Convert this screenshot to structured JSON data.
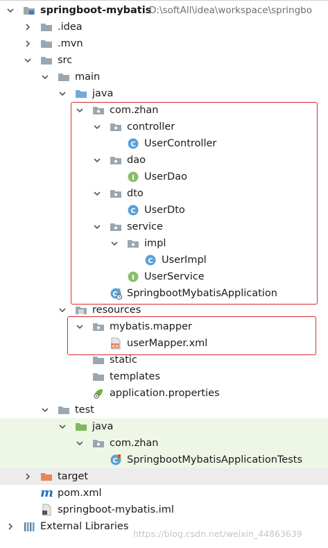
{
  "project_tree": {
    "root": {
      "name": "springboot-mybatis",
      "path": "D:\\softAll\\idea\\workspace\\springbo"
    },
    "idea": ".idea",
    "mvn": ".mvn",
    "src": "src",
    "main": "main",
    "java": "java",
    "com_zhan": "com.zhan",
    "controller": "controller",
    "user_controller": "UserController",
    "dao": "dao",
    "user_dao": "UserDao",
    "dto": "dto",
    "user_dto": "UserDto",
    "service": "service",
    "impl": "impl",
    "user_impl": "UserImpl",
    "user_service": "UserService",
    "app": "SpringbootMybatisApplication",
    "resources": "resources",
    "mybatis_mapper": "mybatis.mapper",
    "user_mapper": "userMapper.xml",
    "static": "static",
    "templates": "templates",
    "application_properties": "application.properties",
    "test": "test",
    "test_java": "java",
    "test_com_zhan": "com.zhan",
    "app_tests": "SpringbootMybatisApplicationTests",
    "target": "target",
    "pom": "pom.xml",
    "iml": "springboot-mybatis.iml",
    "external_libraries": "External Libraries"
  },
  "watermark": "https://blog.csdn.net/weixin_44863639",
  "colors": {
    "folder": "#9aa7b0",
    "source_folder": "#6fa9d8",
    "test_folder": "#7fb95e",
    "target_folder": "#e8875a",
    "class_icon": "#5aa0d8",
    "interface_icon": "#8bbd6d",
    "highlight_box": "#d62a2a",
    "test_row_bg": "#eef7e6"
  }
}
